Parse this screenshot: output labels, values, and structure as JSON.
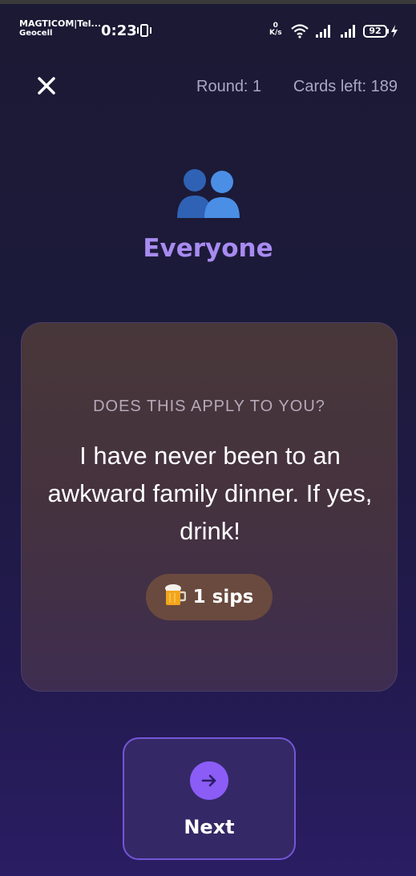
{
  "status_bar": {
    "carrier_line1": "MAGTICOM|Tel...",
    "carrier_line2": "Geocell",
    "time": "0:23",
    "net_speed_value": "0",
    "net_speed_unit": "K/s",
    "battery": "92"
  },
  "header": {
    "round": "Round: 1",
    "cards_left": "Cards left: 189"
  },
  "player": {
    "icon": "two-people-icon",
    "name": "Everyone"
  },
  "card": {
    "question": "DOES THIS APPLY TO YOU?",
    "statement": "I have never been to an awkward family dinner. If yes, drink!",
    "sips_icon": "beer-mug-icon",
    "sips": "1 sips"
  },
  "next_button": {
    "label": "Next",
    "icon": "arrow-right-icon"
  },
  "colors": {
    "accent": "#8b5cf6",
    "player_name": "#a88bf0",
    "badge": "#6a4a3e"
  }
}
